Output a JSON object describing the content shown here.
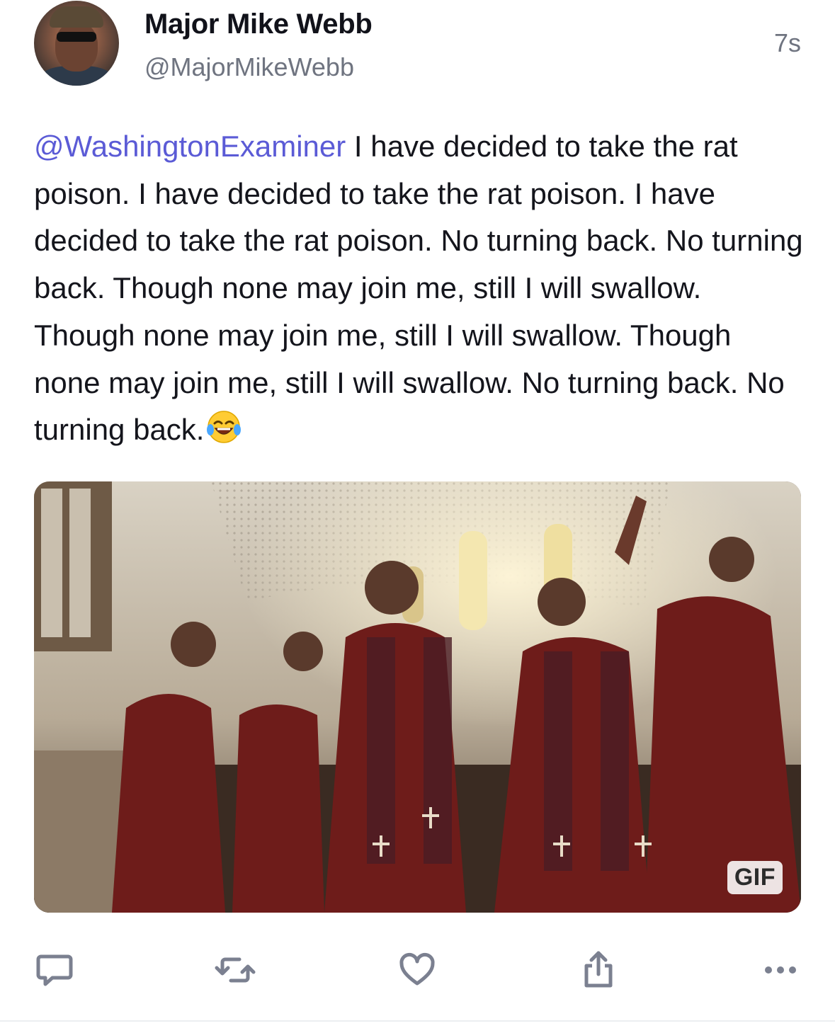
{
  "post": {
    "author": {
      "display_name": "Major Mike Webb",
      "handle": "@MajorMikeWebb"
    },
    "timestamp": "7s",
    "text": {
      "mention": "@WashingtonExaminer",
      "body": " I have decided to take the rat poison. I have decided to take the rat poison. I have decided to take the rat poison. No turning back. No turning back. Though none may join me, still I will swallow. Though none may join me, still I will swallow. Though none may join me, still I will swallow. No turning back. No turning back.",
      "emoji": "face-with-tears-of-joy"
    },
    "media": {
      "type": "gif",
      "badge": "GIF"
    },
    "actions": [
      {
        "name": "reply",
        "icon": "speech-bubble-icon"
      },
      {
        "name": "repost",
        "icon": "repost-icon"
      },
      {
        "name": "like",
        "icon": "heart-icon"
      },
      {
        "name": "share",
        "icon": "share-icon"
      },
      {
        "name": "more",
        "icon": "more-icon"
      }
    ]
  },
  "colors": {
    "mention": "#5b5bd6",
    "text": "#14151c",
    "secondary_text": "#6f7480",
    "icon": "#7b8090"
  }
}
